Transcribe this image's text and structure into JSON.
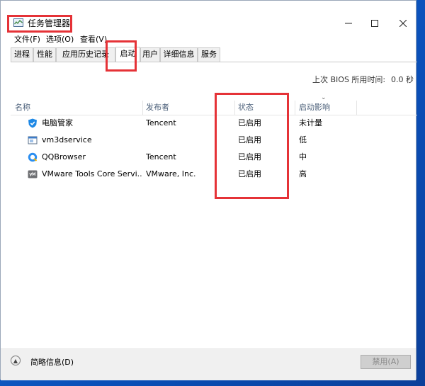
{
  "window": {
    "title": "任务管理器",
    "icon": "task-manager-icon",
    "controls": [
      "minimize-icon",
      "maximize-icon",
      "close-icon"
    ]
  },
  "menu": [
    "文件(F)",
    "选项(O)",
    "查看(V)"
  ],
  "tabs": {
    "items": [
      "进程",
      "性能",
      "应用历史记录",
      "启动",
      "用户",
      "详细信息",
      "服务"
    ],
    "active": "启动"
  },
  "bios": {
    "label": "上次 BIOS 所用时间:",
    "value": "0.0 秒"
  },
  "columns": [
    "名称",
    "发布者",
    "状态",
    "启动影响"
  ],
  "rows": [
    {
      "icon": "pc-manager-shield-icon",
      "name": "电脑管家",
      "publisher": "Tencent",
      "status": "已启用",
      "impact": "未计量"
    },
    {
      "icon": "service-window-icon",
      "name": "vm3dservice",
      "publisher": "",
      "status": "已启用",
      "impact": "低"
    },
    {
      "icon": "qqbrowser-icon",
      "name": "QQBrowser",
      "publisher": "Tencent",
      "status": "已启用",
      "impact": "中"
    },
    {
      "icon": "vmware-icon",
      "name": "VMware Tools Core Servi...",
      "publisher": "VMware, Inc.",
      "status": "已启用",
      "impact": "高"
    }
  ],
  "footer": {
    "brief_label": "简略信息(D)",
    "disable_label": "禁用(A)"
  },
  "colors": {
    "highlight": "#e53237",
    "header_text": "#4c607a",
    "desktop": "#0a4fb8"
  }
}
